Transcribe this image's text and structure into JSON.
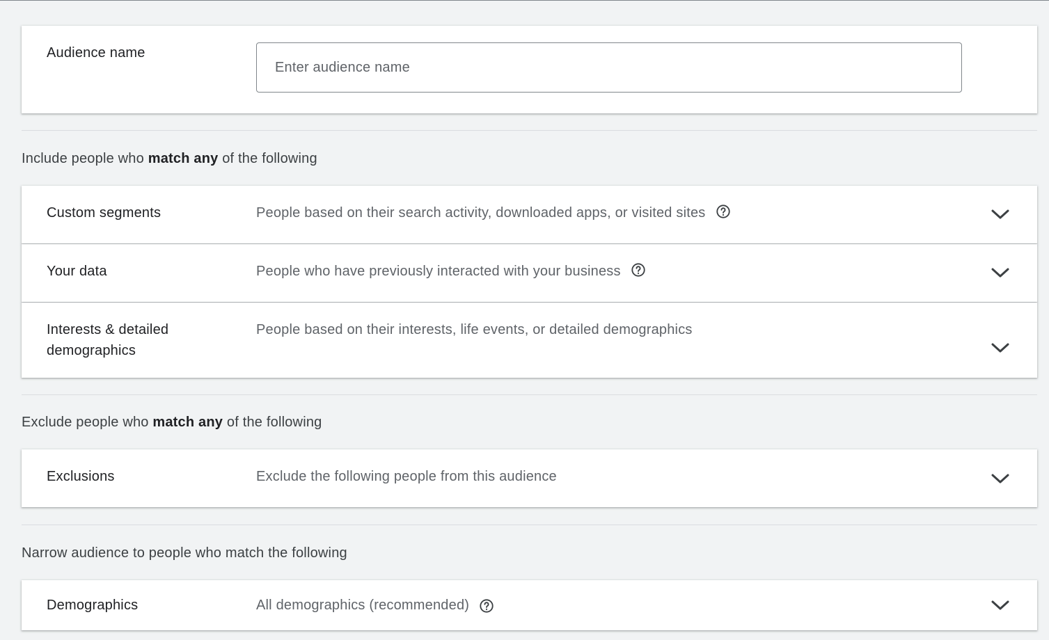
{
  "audience_name": {
    "label": "Audience name",
    "placeholder": "Enter audience name",
    "value": ""
  },
  "include_section": {
    "prefix": "Include people who ",
    "emphasis": "match any",
    "suffix": " of the following",
    "rows": [
      {
        "title": "Custom segments",
        "description": "People based on their search activity, downloaded apps, or visited sites",
        "help_icon": "help-circle-icon"
      },
      {
        "title": "Your data",
        "description": "People who have previously interacted with your business",
        "help_icon": "help-circle-icon"
      },
      {
        "title_line1": "Interests & detailed",
        "title_line2": "demographics",
        "description": "People based on their interests, life events, or detailed demographics"
      }
    ]
  },
  "exclude_section": {
    "prefix": "Exclude people who ",
    "emphasis": "match any",
    "suffix": " of the following",
    "rows": [
      {
        "title": "Exclusions",
        "description": "Exclude the following people from this audience"
      }
    ]
  },
  "narrow_section": {
    "label": "Narrow audience to people who match the following",
    "rows": [
      {
        "title": "Demographics",
        "description": "All demographics (recommended)",
        "help_icon": "help-circle-icon"
      }
    ]
  },
  "colors": {
    "background": "#f1f3f4",
    "card": "#ffffff",
    "title_text": "#202124",
    "secondary_text": "#5f6368"
  }
}
